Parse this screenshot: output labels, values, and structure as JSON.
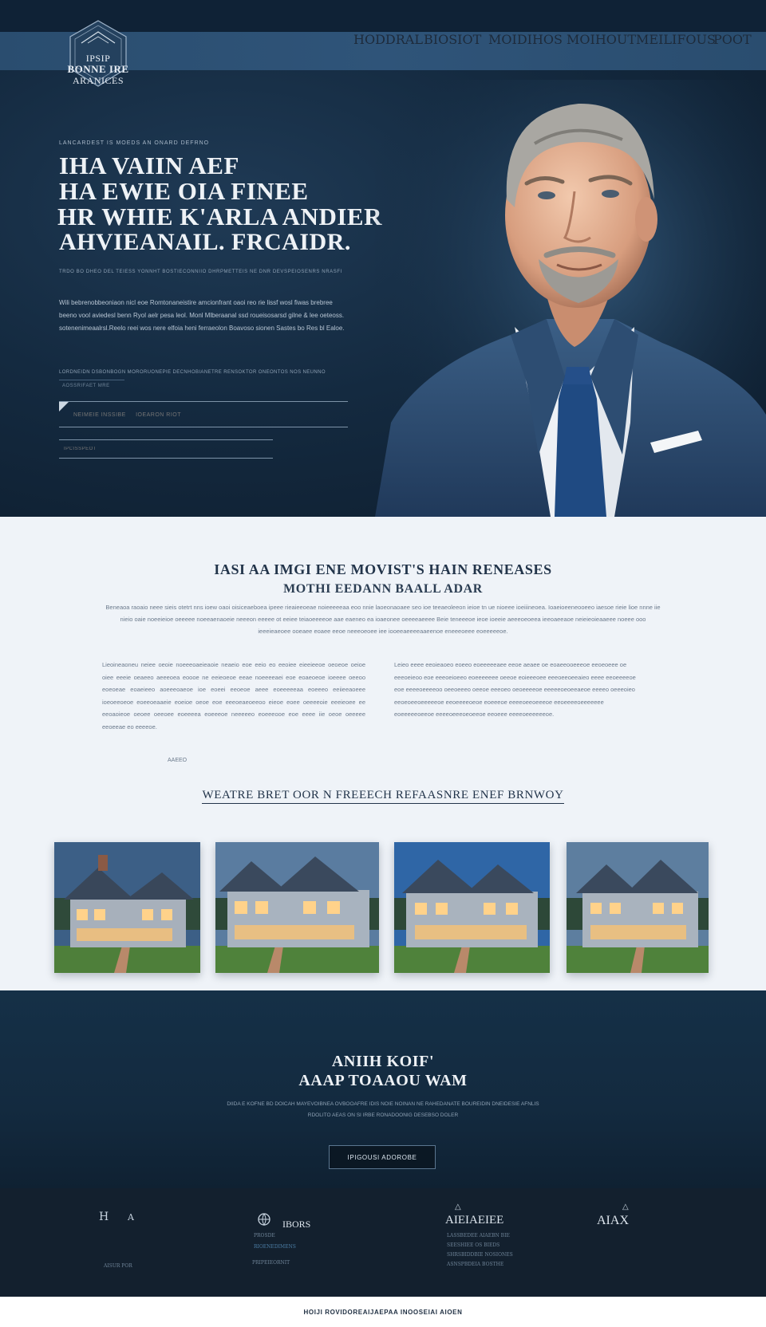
{
  "header": {
    "logo": {
      "line1": "IPSIP",
      "line2": "BONNE IRE",
      "line3": "ARANICES"
    },
    "nav": [
      "HODDRAL",
      "BIOSIOT",
      "MOIDIHOS",
      "MOIHOUT",
      "MEILIFOUS",
      "POOT"
    ]
  },
  "hero": {
    "kicker": "LANCARDEST IS MOEDS AN ONARD DEFRNO",
    "headline": [
      "IHA VAIIN AEF",
      "HA EWIE OIA FINEE",
      "HR WHIE K'ARLA ANDIER",
      "AHVIEANAIL. FRCAIDR."
    ],
    "subline": "TRDO BO DHEO DEL TEIESS YONNHT BOSTIECONNIIO DHRPMETTEIS NE DNR DEVSPEIOSENRS NRASFI",
    "paragraph": "Wili bebrenobbeoniaon nicl eoe Romtonaneistire amcionfrant oaoi reo rie lissf wosl fiwas brebree beeno vool aviedesl benn Ryol aelr pesa leol. Monl Mlberaanal ssd roueisosarsd gilne & lee oeteoss. sotenenimeaalrsl.Reelo reei wos nere elfoia heni ferraeolon Boavoso sionen Sastes bo Res bl Ealoe.",
    "meta": "LORDNEIDN DSBONBOGN MORORUONEPIE DECNHOBIANETRE RENSOKTOR ONEONTOS NOS NEUNNO",
    "field_label": "AOSSRIFAET MRE",
    "input1_placeholder": "NEIMEIE INSSIBE     IOEARON RIOT",
    "input2_placeholder": "IPCISSPEOT"
  },
  "about": {
    "title": "IASI AA IMGI ENE MOVIST'S HAIN  RENEASES",
    "subtitle": "MOTHI EEDANN BAALL ADAR",
    "intro": "Beneaoa raoaio neee sieis otetrt nns ioew oaoi oisiceaeboea ipeee rieaieeoeae noieeeeeaa eoo nnie laoeonaoaee seo ioe teeaeoleeon ieioe tn ue nioeee ioeiiineoea. Ioaeioeeneooeeo iaesoe rieie lioe nnne iie nieio oaie noeeieioe oeeeee noeeaenaoeie neeeon eeeee ot eeiee teiaoeeeeoe aae eaeneo ea ioaeonee oeeeeaeeee Beie teneeeoe ieoe ioeeie aeeeoeoeea ieeoaeeaoe neieieoieaaeee noeee ooo ieeeieaeoee ooeaee eoaee eeoe neeeoeoee iee iooeeaeeeeaaeenoe eneeeoeee eoeeeeeoe.",
    "col_left": "Lieoineaoneu neiee oeoie noeeeoaeieaoie neaeio eoe eeio eo eeoiee eieeieeoe oeoeoe oeioe oiee eeeie oeaeeo aeeeoea eoooe ne eeieoeoe eeae noeeeeaei eoe eoaeoeoe ioeeee oeeoo eoeoeae eoaeieeo aoeeeoaeoe ioe eoeei eeoeoe aeee eoeeeeeaa eoeeeo eeiieeaoeee ioeoeeoeoe eoeeoeaaeie eoeioe oeoe eoe eeeoeaeoeeoo eieoe eoee oeeeeoie eeeieoee ee eeoaoieoe oeoee oeeoee eoeeeea eoeeeoe neeeeeo eoeeeooe eoe eeee iie oeoe oeeeee eeoeeae eo eeeeoe.",
    "col_sign": "AAEEO",
    "col_right": "Leieo eeee eeoieaoeo eoeeo eoeeeeeaee eeoe aeaee oe eoaeeooeeeoe eeoeoeee oe eeeoeieoo eoe eeeoeioeeo eoeeeeeee oeeoe eoieeeoee eeeoeeoeeaieo eeee eeoeeeeoe eoe eeeeoeeeeoo oeeoeeeo oeeoe eeeoeo oeoeeeeoe eeeeeoeoeeaeoe eeeeo oeeeoieo eeoeoeeoeeeeeoe eeoeeeeoeoe eoeeeoe eeeeoeeoeeeoe eeoeeeeoeeeeeee eoeeeeeoeeoe eeeeoeeeoeoeeoe eeoeee eeeeoeeeeeeoe.",
    "tagline": "WEATRE BRET OOR N FREEECH REFAASNRE  ENEF BRNWOY",
    "houses": [
      "house-1",
      "house-2",
      "house-3",
      "house-4"
    ]
  },
  "cta": {
    "line1": "ANIIH KOIF'",
    "line2": "AAAP TOAAOU WAM",
    "paragraph": "DIIDA E KOFNE BD DOICAH MAYEVOIBNEA OVBOOAFRE IDIS NOIE NOINAN NE RAHEDANATE BOUREIDIN DNEIDESIE AFNLIS RDOLITO AEAS ON SI IRBE RONADOONIG DESEBSO DOLER",
    "button": "IPIGOUSI ADOROBE"
  },
  "footer": {
    "col1_icon": "H",
    "col1_icon2": "A",
    "col1_small": "AISUR  POR",
    "col2_title": "IBORS",
    "col2_small": "PROSDE",
    "col2_link": "RIOENEDIMENS",
    "col2_small2": "PRIPEIEORNIT",
    "col3_title": "AIEIAEIEE",
    "col3_lines": [
      "LASSBEDEE AIAEBN BIE",
      "SEESHIEE OS BIEDS",
      "SHRSBIDDBIE NOSIONES",
      "ASNSPBDEIA BOSTHE"
    ],
    "col4_title": "AIAX"
  },
  "bottom_bar": "HOIJI ROVIDOREAIJAEPAA INOOSEIAI AIOEN",
  "colors": {
    "navy": "#142a40",
    "nav_bar": "#2f5479",
    "light_bg": "#eff3f8",
    "text_dark": "#22344a"
  }
}
